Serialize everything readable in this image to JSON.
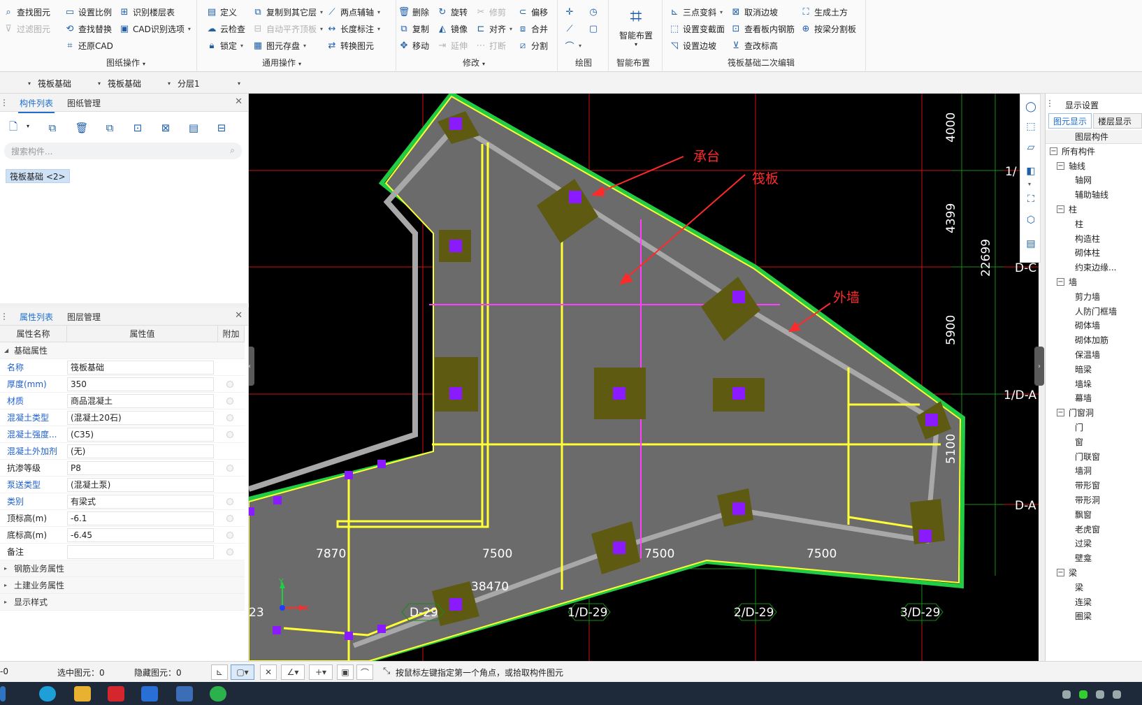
{
  "ribbon": {
    "groups": [
      {
        "label": "图纸操作",
        "has_dropdown": true
      },
      {
        "label": "通用操作",
        "has_dropdown": true
      },
      {
        "label": "修改",
        "has_dropdown": true
      },
      {
        "label": "绘图"
      },
      {
        "label": "智能布置"
      },
      {
        "label": "筏板基础二次编辑"
      }
    ],
    "col0": [
      {
        "label": "查找图元"
      },
      {
        "label": "过滤图元",
        "disabled": true
      }
    ],
    "col1": [
      {
        "label": "设置比例"
      },
      {
        "label": "查找替换"
      },
      {
        "label": "还原CAD"
      }
    ],
    "col2": [
      {
        "label": "识别楼层表"
      },
      {
        "label": "CAD识别选项"
      }
    ],
    "col3": [
      {
        "label": "定义"
      },
      {
        "label": "云检查"
      },
      {
        "label": "锁定"
      }
    ],
    "col4": [
      {
        "label": "复制到其它层"
      },
      {
        "label": "自动平齐顶板",
        "disabled": true
      },
      {
        "label": "图元存盘"
      }
    ],
    "col5": [
      {
        "label": "两点辅轴"
      },
      {
        "label": "长度标注"
      },
      {
        "label": "转换图元"
      }
    ],
    "col6": [
      {
        "label": "删除"
      },
      {
        "label": "复制"
      },
      {
        "label": "移动"
      }
    ],
    "col7": [
      {
        "label": "旋转"
      },
      {
        "label": "镜像"
      },
      {
        "label": "延伸",
        "disabled": true
      }
    ],
    "col8": [
      {
        "label": "修剪",
        "disabled": true
      },
      {
        "label": "对齐"
      },
      {
        "label": "打断",
        "disabled": true
      }
    ],
    "col9": [
      {
        "label": "偏移"
      },
      {
        "label": "合并"
      },
      {
        "label": "分割"
      }
    ],
    "smart_layout_label": "智能布置",
    "col10": [
      {
        "label": "三点变斜"
      },
      {
        "label": "设置变截面"
      },
      {
        "label": "设置边坡"
      }
    ],
    "col11": [
      {
        "label": "取消边坡"
      },
      {
        "label": "查看板内钢筋"
      },
      {
        "label": "查改标高"
      }
    ],
    "col12": [
      {
        "label": "生成土方"
      },
      {
        "label": "按梁分割板"
      }
    ]
  },
  "selectors": [
    {
      "value": ""
    },
    {
      "value": "筏板基础"
    },
    {
      "value": "筏板基础"
    },
    {
      "value": "分层1"
    }
  ],
  "component_panel": {
    "tabs": [
      "构件列表",
      "图纸管理"
    ],
    "search_placeholder": "搜索构件...",
    "items": [
      "筏板基础 <2>"
    ]
  },
  "property_panel": {
    "tabs": [
      "属性列表",
      "图层管理"
    ],
    "headers": [
      "属性名称",
      "属性值",
      "附加"
    ],
    "section_basic": "基础属性",
    "rows": [
      {
        "name": "名称",
        "value": "筏板基础",
        "blue": true,
        "dot": false
      },
      {
        "name": "厚度(mm)",
        "value": "350",
        "blue": true,
        "dot": true
      },
      {
        "name": "材质",
        "value": "商品混凝土",
        "blue": true,
        "dot": true
      },
      {
        "name": "混凝土类型",
        "value": "(混凝土20石)",
        "blue": true,
        "dot": true
      },
      {
        "name": "混凝土强度...",
        "value": "(C35)",
        "blue": true,
        "dot": true
      },
      {
        "name": "混凝土外加剂",
        "value": "(无)",
        "blue": true,
        "dot": false
      },
      {
        "name": "抗渗等级",
        "value": "P8",
        "blue": false,
        "dot": true
      },
      {
        "name": "泵送类型",
        "value": "(混凝土泵)",
        "blue": true,
        "dot": false
      },
      {
        "name": "类别",
        "value": "有梁式",
        "blue": true,
        "dot": true
      },
      {
        "name": "顶标高(m)",
        "value": "-6.1",
        "blue": false,
        "dot": true
      },
      {
        "name": "底标高(m)",
        "value": "-6.45",
        "blue": false,
        "dot": true
      },
      {
        "name": "备注",
        "value": "",
        "blue": false,
        "dot": true
      }
    ],
    "sections_collapsed": [
      "钢筋业务属性",
      "土建业务属性",
      "显示样式"
    ]
  },
  "canvas": {
    "annotations": [
      "承台",
      "筏板",
      "外墙"
    ],
    "dims_bottom": [
      "7870",
      "7500",
      "7500",
      "7500"
    ],
    "dim_total_bottom": "38470",
    "dims_right": [
      "4000",
      "4399",
      "5900",
      "5100"
    ],
    "dim_total_right": "22699",
    "axis_labels_bottom": [
      "23",
      "D-29",
      "1/D-29",
      "2/D-29",
      "3/D-29"
    ],
    "axis_labels_right": [
      "1/",
      "D-C",
      "1/D-A",
      "D-A"
    ],
    "ucs": {
      "y": "Y",
      "x": "X"
    },
    "colors": {
      "slab_fill": "#6b6b6b",
      "slab_edge": "#ffff33",
      "outer_band": "#22cc44",
      "wall": "#a8a8a8",
      "beam": "#ffff33",
      "beam_magenta": "#ff40ff",
      "pile_cap": "#5e5a12",
      "column": "#8a1aff",
      "axis_red": "#d01010",
      "axis_green": "#1a8a1a",
      "annotation": "#ff2a2a"
    }
  },
  "display_settings": {
    "title": "显示设置",
    "tabs": [
      "图元显示",
      "楼层显示"
    ],
    "column_header": "图层构件",
    "tree": [
      {
        "label": "所有构件",
        "level": 0,
        "box": "−"
      },
      {
        "label": "轴线",
        "level": 1,
        "box": "−"
      },
      {
        "label": "轴网",
        "level": 2
      },
      {
        "label": "辅助轴线",
        "level": 2
      },
      {
        "label": "柱",
        "level": 1,
        "box": "−"
      },
      {
        "label": "柱",
        "level": 2
      },
      {
        "label": "构造柱",
        "level": 2
      },
      {
        "label": "砌体柱",
        "level": 2
      },
      {
        "label": "约束边缘...",
        "level": 2
      },
      {
        "label": "墙",
        "level": 1,
        "box": "−"
      },
      {
        "label": "剪力墙",
        "level": 2
      },
      {
        "label": "人防门框墙",
        "level": 2
      },
      {
        "label": "砌体墙",
        "level": 2
      },
      {
        "label": "砌体加筋",
        "level": 2
      },
      {
        "label": "保温墙",
        "level": 2
      },
      {
        "label": "暗梁",
        "level": 2
      },
      {
        "label": "墙垛",
        "level": 2
      },
      {
        "label": "幕墙",
        "level": 2
      },
      {
        "label": "门窗洞",
        "level": 1,
        "box": "−"
      },
      {
        "label": "门",
        "level": 2
      },
      {
        "label": "窗",
        "level": 2
      },
      {
        "label": "门联窗",
        "level": 2
      },
      {
        "label": "墙洞",
        "level": 2
      },
      {
        "label": "带形窗",
        "level": 2
      },
      {
        "label": "带形洞",
        "level": 2
      },
      {
        "label": "飘窗",
        "level": 2
      },
      {
        "label": "老虎窗",
        "level": 2
      },
      {
        "label": "过梁",
        "level": 2
      },
      {
        "label": "壁龛",
        "level": 2
      },
      {
        "label": "梁",
        "level": 1,
        "box": "−"
      },
      {
        "label": "梁",
        "level": 2
      },
      {
        "label": "连梁",
        "level": 2
      },
      {
        "label": "圈梁",
        "level": 2
      }
    ]
  },
  "statusbar": {
    "left_value": "-0",
    "selected": "选中图元：0",
    "hidden": "隐藏图元：0",
    "hint": "按鼠标左键指定第一个角点，或拾取构件图元"
  }
}
